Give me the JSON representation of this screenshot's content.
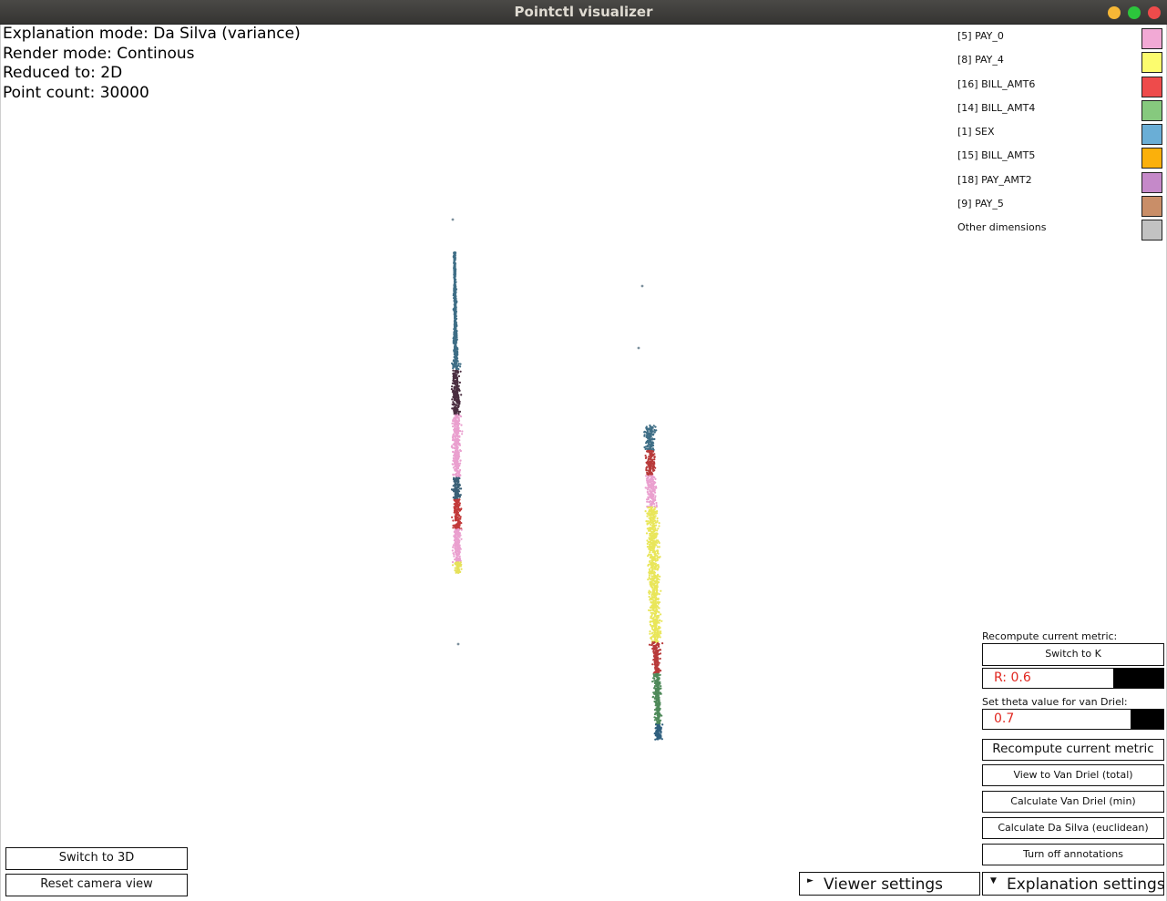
{
  "window": {
    "title": "Pointctl visualizer"
  },
  "info": {
    "explanation_mode": "Explanation mode: Da Silva (variance)",
    "render_mode": "Render mode: Continous",
    "reduced_to": "Reduced to: 2D",
    "point_count": "Point count: 30000"
  },
  "legend": [
    {
      "label": "[5] PAY_0",
      "color": "#f2a9d5"
    },
    {
      "label": "[8] PAY_4",
      "color": "#fcfc6e"
    },
    {
      "label": "[16] BILL_AMT6",
      "color": "#ee4b4b"
    },
    {
      "label": "[14] BILL_AMT4",
      "color": "#86c97e"
    },
    {
      "label": "[1] SEX",
      "color": "#6aaed6"
    },
    {
      "label": "[15] BILL_AMT5",
      "color": "#fbb00b"
    },
    {
      "label": "[18] PAY_AMT2",
      "color": "#c589c9"
    },
    {
      "label": "[9] PAY_5",
      "color": "#c98e68"
    },
    {
      "label": "Other dimensions",
      "color": "#c2c2c2"
    }
  ],
  "panel": {
    "recompute_label": "Recompute current metric:",
    "switch_k": "Switch to K",
    "r_slider": {
      "text": "R: 0.6",
      "value": 0.6
    },
    "theta_label": "Set theta value for van Driel:",
    "theta_slider": {
      "text": "0.7",
      "value": 0.7
    },
    "recompute_button": "Recompute current metric",
    "view_van_driel": "View to Van Driel (total)",
    "calc_van_driel": "Calculate Van Driel (min)",
    "calc_da_silva": "Calculate Da Silva (euclidean)",
    "annotations": "Turn off annotations"
  },
  "bottom": {
    "switch_3d": "Switch to 3D",
    "reset_camera": "Reset camera view",
    "viewer_settings": "Viewer settings",
    "explanation_settings": "Explanation settings",
    "viewer_arrow": "►",
    "explanation_arrow": "▼"
  },
  "clusters": {
    "left": [
      {
        "color": "#3f6e86",
        "share": 0.32
      },
      {
        "color": "#4a2e40",
        "share": 0.12
      },
      {
        "color": "#eaa0cf",
        "share": 0.17
      },
      {
        "color": "#3a6077",
        "share": 0.06
      },
      {
        "color": "#c23a3a",
        "share": 0.08
      },
      {
        "color": "#eaa0cf",
        "share": 0.09
      },
      {
        "color": "#e6e15a",
        "share": 0.03
      }
    ],
    "right": [
      {
        "color": "#3f6e86",
        "share": 0.08
      },
      {
        "color": "#b83a3a",
        "share": 0.08
      },
      {
        "color": "#eaa0cf",
        "share": 0.1
      },
      {
        "color": "#e9e65a",
        "share": 0.43
      },
      {
        "color": "#b83a3a",
        "share": 0.1
      },
      {
        "color": "#4f8a5a",
        "share": 0.16
      },
      {
        "color": "#2f5f7e",
        "share": 0.05
      }
    ]
  }
}
